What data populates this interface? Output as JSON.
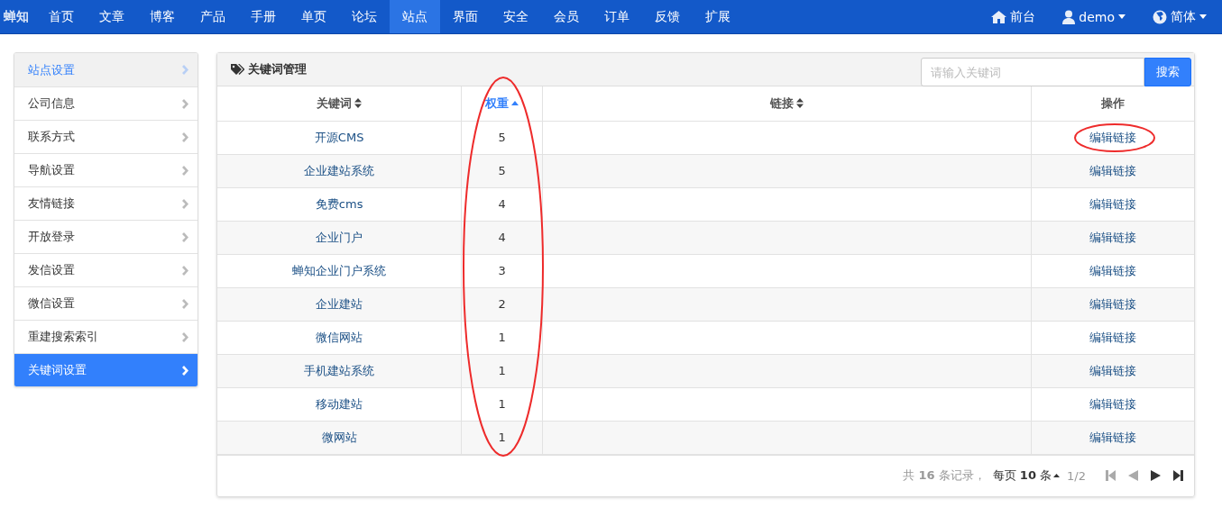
{
  "navbar": {
    "brand": "蝉知",
    "items": [
      {
        "label": "首页",
        "selected": false
      },
      {
        "label": "文章",
        "selected": false
      },
      {
        "label": "博客",
        "selected": false
      },
      {
        "label": "产品",
        "selected": false
      },
      {
        "label": "手册",
        "selected": false
      },
      {
        "label": "单页",
        "selected": false
      },
      {
        "label": "论坛",
        "selected": false
      },
      {
        "label": "站点",
        "selected": true
      },
      {
        "label": "界面",
        "selected": false
      },
      {
        "label": "安全",
        "selected": false
      },
      {
        "label": "会员",
        "selected": false
      },
      {
        "label": "订单",
        "selected": false
      },
      {
        "label": "反馈",
        "selected": false
      },
      {
        "label": "扩展",
        "selected": false
      }
    ],
    "right": [
      {
        "kind": "home",
        "label": "前台"
      },
      {
        "kind": "user",
        "label": "demo"
      },
      {
        "kind": "globe",
        "label": "简体"
      }
    ]
  },
  "sidebar": {
    "items": [
      {
        "label": "站点设置",
        "kind": "heading",
        "selected": false
      },
      {
        "label": "公司信息",
        "kind": "link",
        "selected": false
      },
      {
        "label": "联系方式",
        "kind": "link",
        "selected": false
      },
      {
        "label": "导航设置",
        "kind": "link",
        "selected": false
      },
      {
        "label": "友情链接",
        "kind": "link",
        "selected": false
      },
      {
        "label": "开放登录",
        "kind": "link",
        "selected": false
      },
      {
        "label": "发信设置",
        "kind": "link",
        "selected": false
      },
      {
        "label": "微信设置",
        "kind": "link",
        "selected": false
      },
      {
        "label": "重建搜索索引",
        "kind": "link",
        "selected": false
      },
      {
        "label": "关键词设置",
        "kind": "link",
        "selected": true
      }
    ]
  },
  "panel": {
    "title": "关键词管理",
    "search": {
      "placeholder": "请输入关键词",
      "button": "搜索"
    },
    "columns": [
      {
        "label": "关键词",
        "sortable": true,
        "selected": false
      },
      {
        "label": "权重",
        "sortable": true,
        "selected": true
      },
      {
        "label": "链接",
        "sortable": true,
        "selected": false
      },
      {
        "label": "操作",
        "sortable": false,
        "selected": false
      }
    ],
    "rows": [
      {
        "keyword": "开源CMS",
        "weight": "5",
        "action": "编辑链接"
      },
      {
        "keyword": "企业建站系统",
        "weight": "5",
        "action": "编辑链接"
      },
      {
        "keyword": "免费cms",
        "weight": "4",
        "action": "编辑链接"
      },
      {
        "keyword": "企业门户",
        "weight": "4",
        "action": "编辑链接"
      },
      {
        "keyword": "蝉知企业门户系统",
        "weight": "3",
        "action": "编辑链接"
      },
      {
        "keyword": "企业建站",
        "weight": "2",
        "action": "编辑链接"
      },
      {
        "keyword": "微信网站",
        "weight": "1",
        "action": "编辑链接"
      },
      {
        "keyword": "手机建站系统",
        "weight": "1",
        "action": "编辑链接"
      },
      {
        "keyword": "移动建站",
        "weight": "1",
        "action": "编辑链接"
      },
      {
        "keyword": "微网站",
        "weight": "1",
        "action": "编辑链接"
      }
    ],
    "pager": {
      "summary": "共 **16** 条记录，",
      "per_page": "每页 **10** 条",
      "page": "1/2",
      "buttons": [
        {
          "kind": "first",
          "disabled": true
        },
        {
          "kind": "prev",
          "disabled": true
        },
        {
          "kind": "next",
          "disabled": false
        },
        {
          "kind": "last",
          "disabled": false
        }
      ]
    }
  }
}
